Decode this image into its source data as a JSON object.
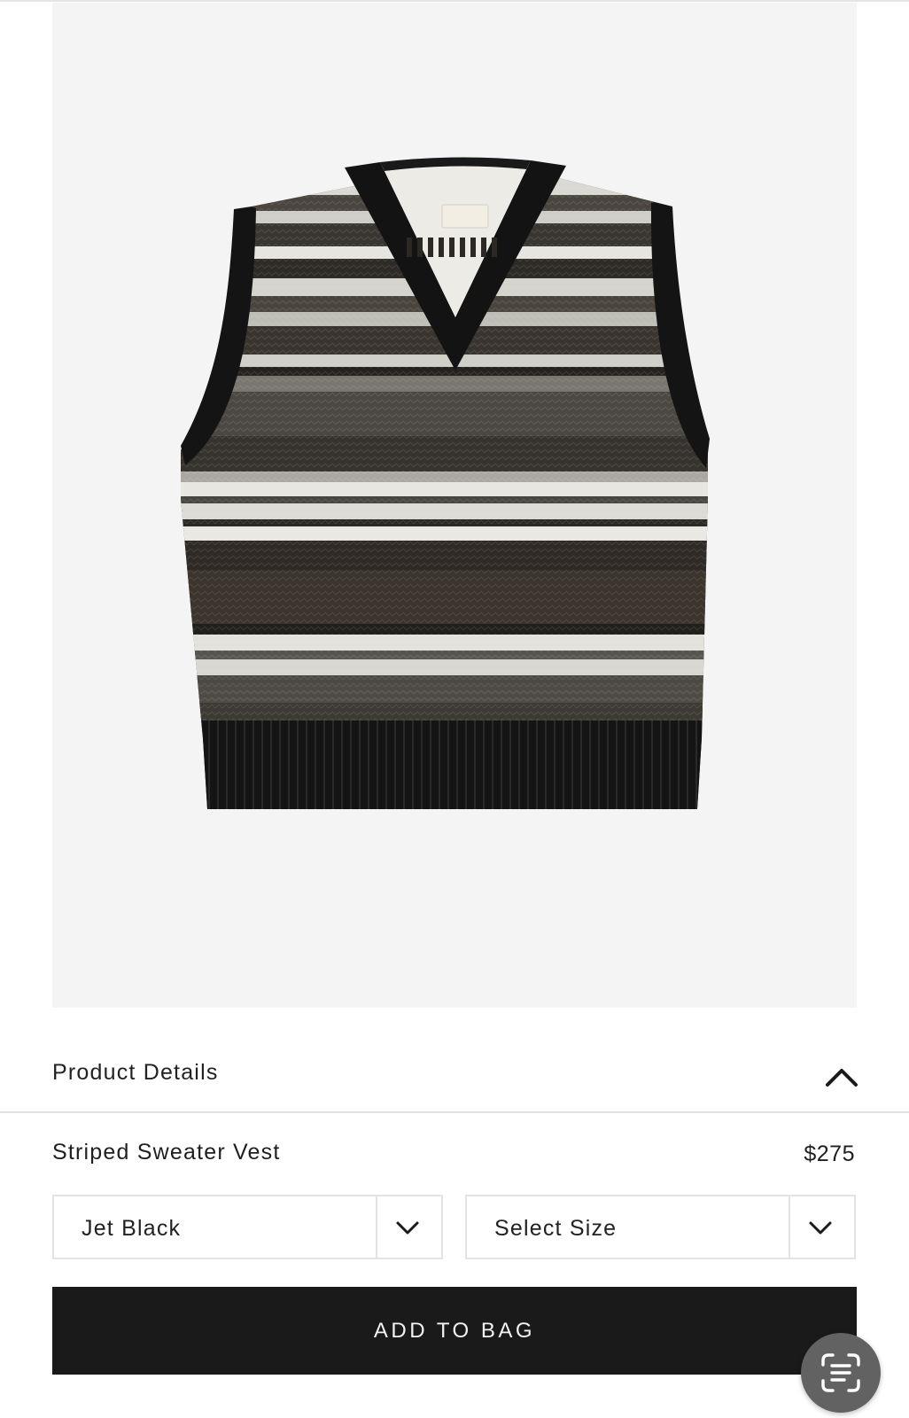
{
  "product": {
    "details_label": "Product Details",
    "name": "Striped Sweater Vest",
    "price": "$275",
    "image_alt": "Striped sweater vest"
  },
  "color_select": {
    "value": "Jet Black"
  },
  "size_select": {
    "value": "Select Size"
  },
  "actions": {
    "add_to_bag_label": "ADD TO BAG"
  },
  "icons": {
    "details_toggle": "chevron-up-icon",
    "dropdown": "chevron-down-icon",
    "scan": "scan-text-icon"
  },
  "colors": {
    "image_bg": "#f4f4f4",
    "button_bg": "#1a1a1a",
    "button_text": "#f2f2f2",
    "scan_bg": "#626262"
  }
}
